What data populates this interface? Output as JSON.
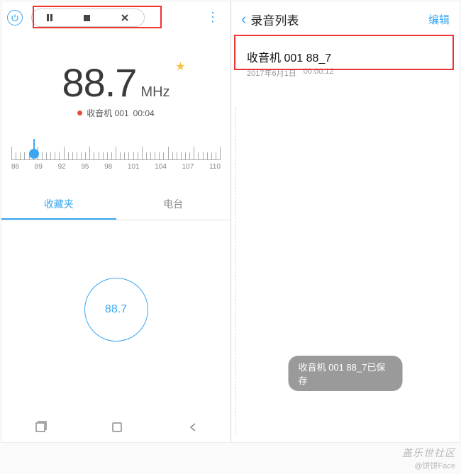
{
  "left": {
    "frequency": "88.7",
    "unit": "MHz",
    "recording_label": "收音机 001",
    "recording_time": "00:04",
    "dial": {
      "labels": [
        "86",
        "89",
        "92",
        "95",
        "98",
        "101",
        "104",
        "107",
        "110"
      ],
      "position_pct": 11
    },
    "tabs": {
      "favorites": "收藏夹",
      "stations": "电台"
    },
    "preset": "88.7"
  },
  "right": {
    "title": "录音列表",
    "edit": "编辑",
    "item": {
      "name": "收音机 001 88_7",
      "date": "2017年6月1日",
      "duration": "00:00:12"
    },
    "toast": "收音机 001 88_7已保存"
  },
  "watermark": {
    "line1": "盖乐世社区",
    "line2": "@饼饼Face"
  }
}
